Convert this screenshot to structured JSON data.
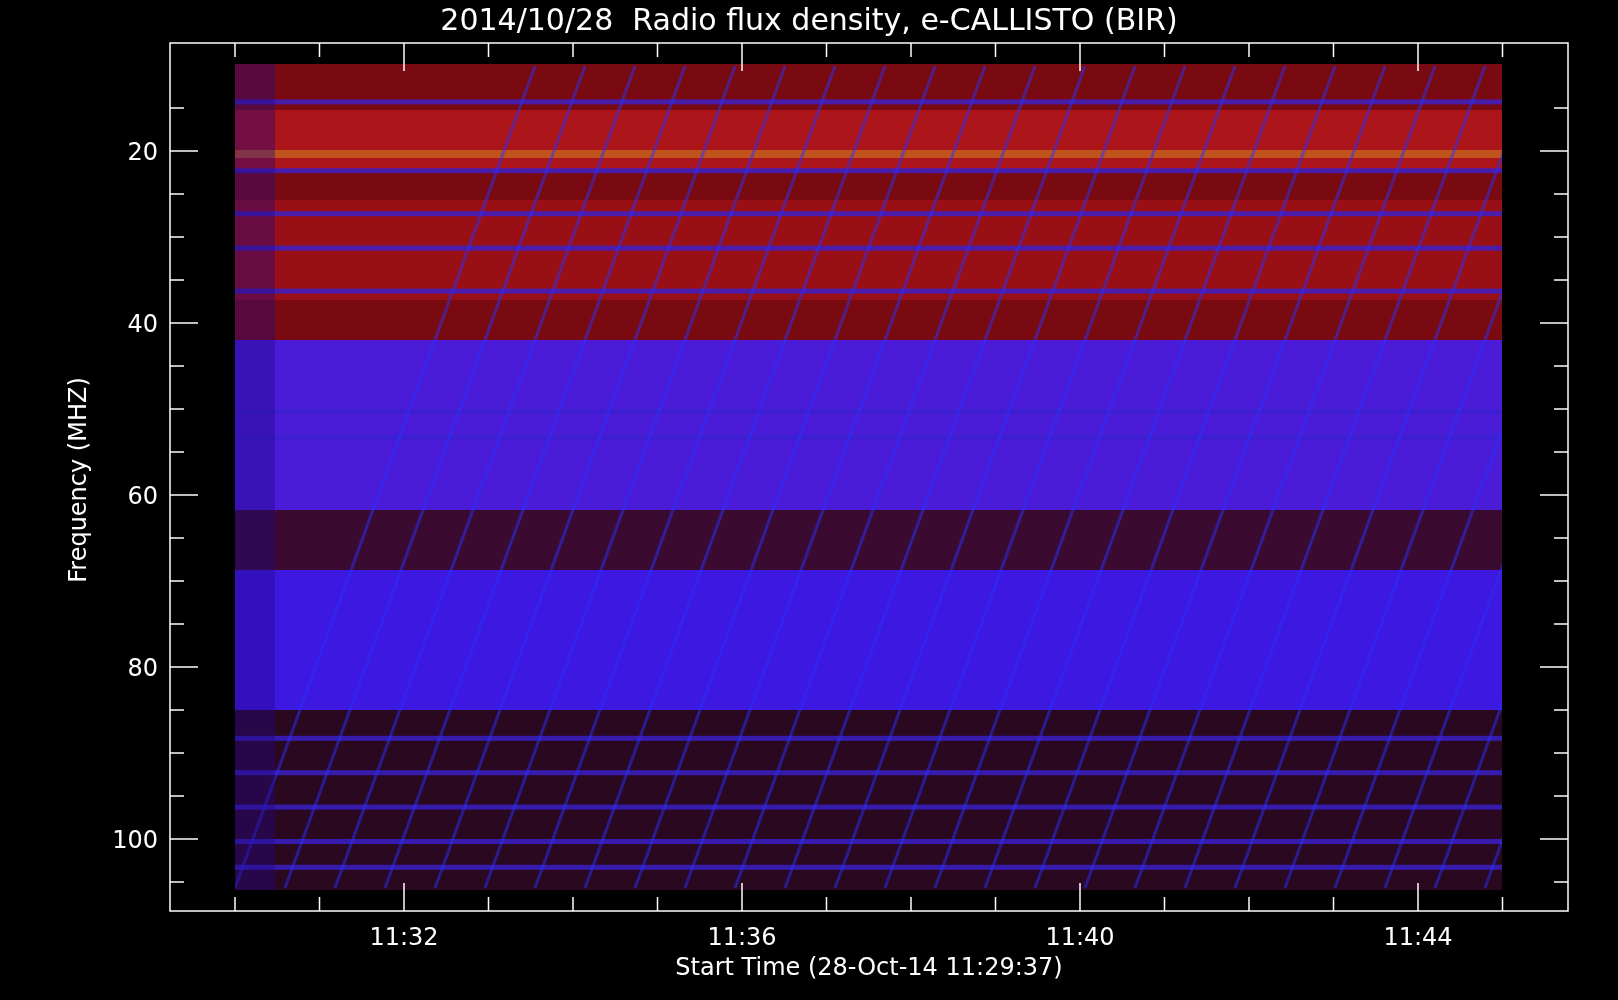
{
  "title": "2014/10/28  Radio flux density, e-CALLISTO (BIR)",
  "ylabel": "Frequency (MHZ)",
  "xlabel": "Start Time (28-Oct-14 11:29:37)",
  "yticks": [
    "20",
    "40",
    "60",
    "80",
    "100"
  ],
  "xticks": [
    "11:32",
    "11:36",
    "11:40",
    "11:44"
  ]
}
